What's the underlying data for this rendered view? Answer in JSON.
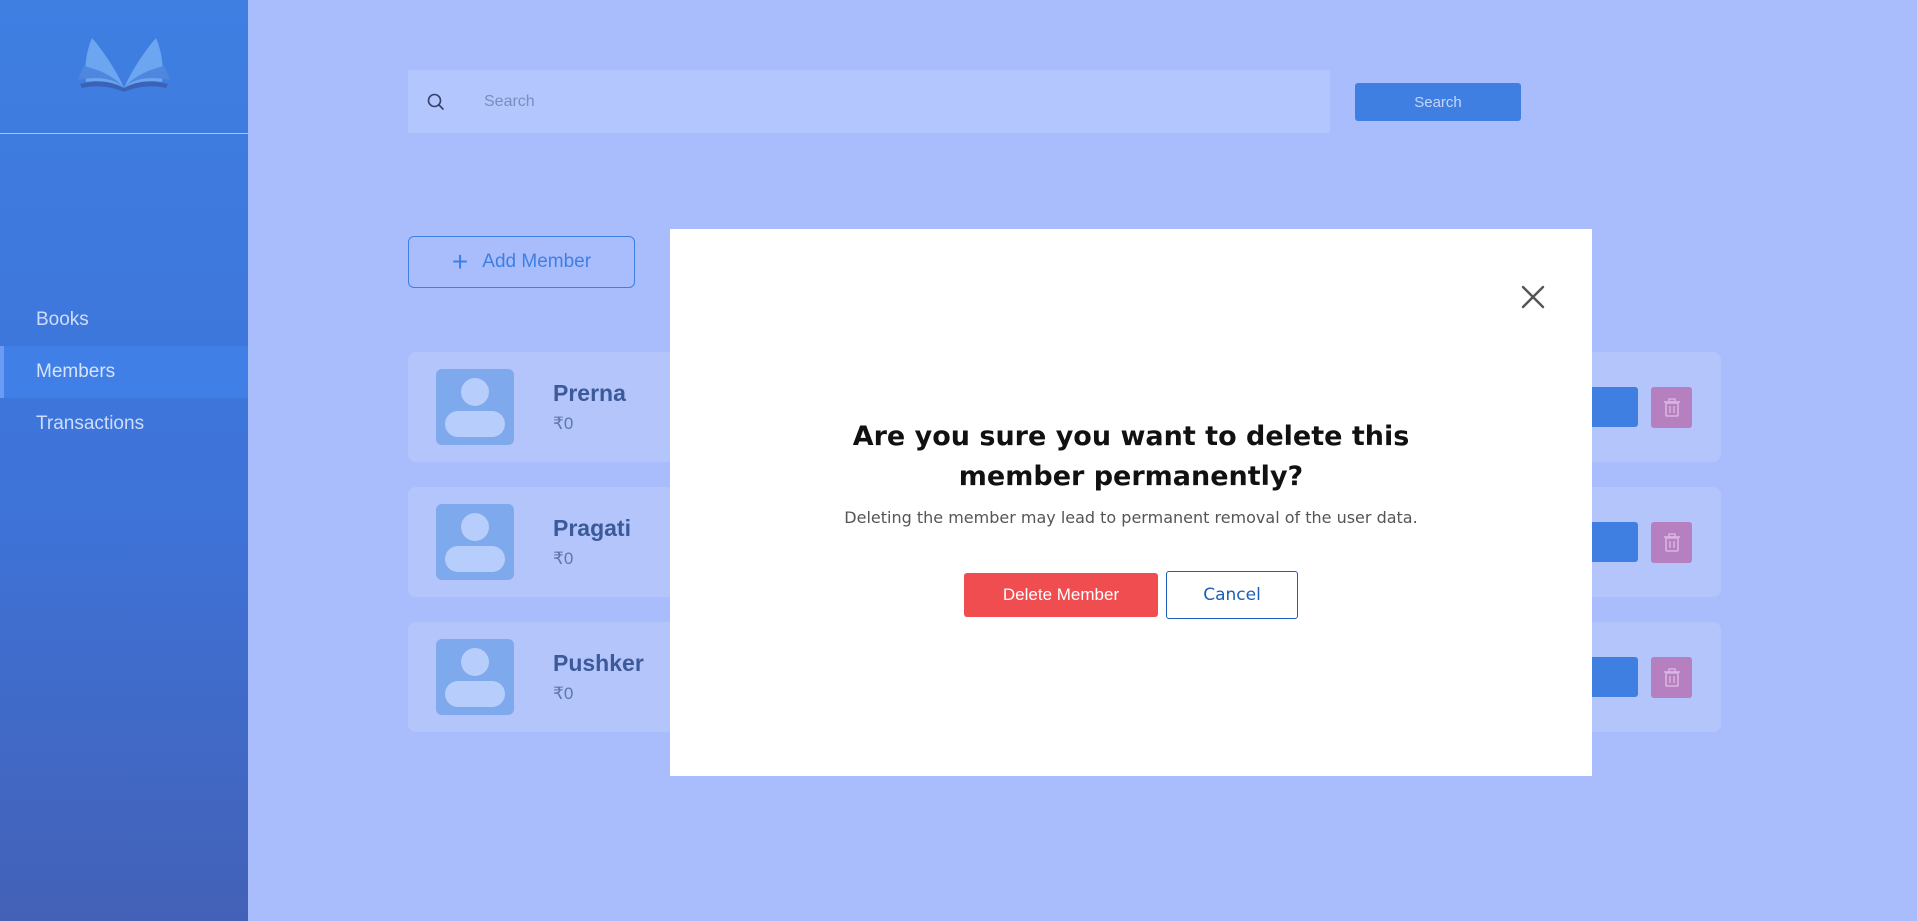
{
  "sidebar": {
    "logo": "open-book-logo",
    "items": [
      {
        "label": "Books",
        "active": false
      },
      {
        "label": "Members",
        "active": true
      },
      {
        "label": "Transactions",
        "active": false
      }
    ]
  },
  "search": {
    "placeholder": "Search",
    "value": "",
    "button_label": "Search"
  },
  "add_member": {
    "label": "Add Member",
    "icon": "plus-icon"
  },
  "members": [
    {
      "name": "Prerna",
      "fine": "₹0"
    },
    {
      "name": "Pragati",
      "fine": "₹0"
    },
    {
      "name": "Pushker",
      "fine": "₹0"
    }
  ],
  "modal": {
    "title": "Are you sure you want to delete this member permanently?",
    "subtitle": "Deleting the member may lead to permanent removal of the user data.",
    "confirm_label": "Delete Member",
    "cancel_label": "Cancel"
  },
  "colors": {
    "background": "#a9bdfd",
    "sidebar": "#3f7fe2",
    "accent": "#3f7fe2",
    "danger": "#ef4d50",
    "cancel": "#1d5fb8"
  }
}
